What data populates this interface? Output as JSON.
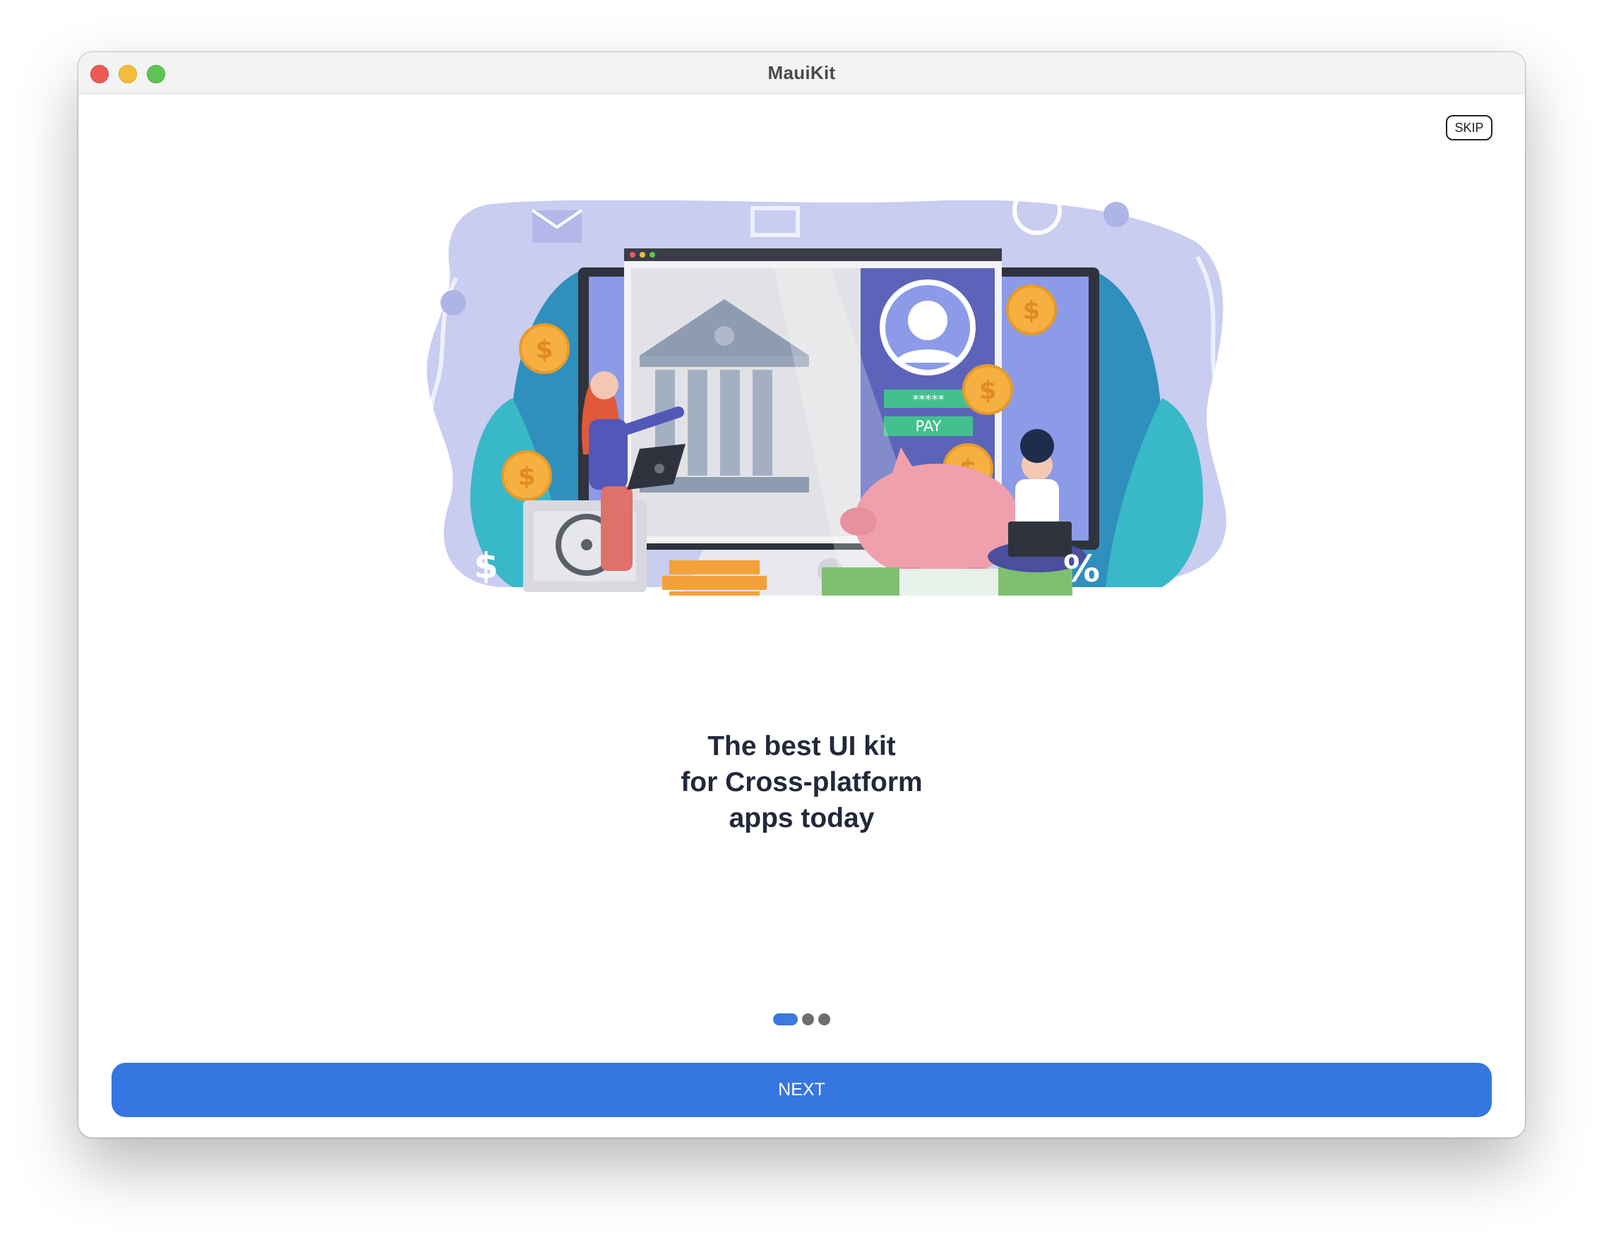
{
  "window": {
    "title": "MauiKit"
  },
  "header": {
    "skip_label": "SKIP"
  },
  "illustration": {
    "pay_label": "PAY",
    "password_label": "*****",
    "percent_label": "%",
    "dollar_label": "$"
  },
  "onboarding": {
    "headline_lines": [
      "The best UI kit",
      "for Cross-platform",
      "apps today"
    ],
    "page_count": 3,
    "current_page": 1
  },
  "footer": {
    "next_label": "NEXT"
  },
  "colors": {
    "accent": "#3676e0",
    "dot_inactive": "#6e6e6e",
    "headline": "#23283a"
  }
}
